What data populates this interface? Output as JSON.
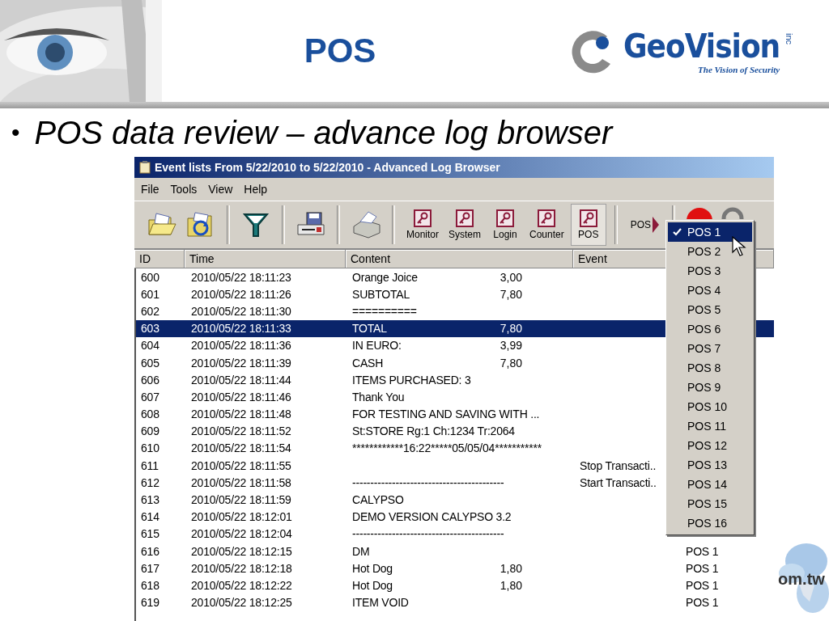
{
  "slide": {
    "title": "POS",
    "logo": {
      "name": "GeoVision",
      "suffix": "inc",
      "tagline": "The Vision of Security"
    },
    "bullet_mark": "•",
    "bullet": "POS data review – advance log browser",
    "corner_text": "om.tw"
  },
  "window": {
    "title": "Event lists From 5/22/2010 to 5/22/2010 - Advanced Log Browser"
  },
  "menu_bar": [
    "File",
    "Tools",
    "View",
    "Help"
  ],
  "toolbar": {
    "log_buttons": [
      {
        "label": "Monitor",
        "selected": false
      },
      {
        "label": "System",
        "selected": false
      },
      {
        "label": "Login",
        "selected": false
      },
      {
        "label": "Counter",
        "selected": false
      },
      {
        "label": "POS",
        "selected": true
      }
    ],
    "pos_menu_label": "POS"
  },
  "table": {
    "columns": [
      "ID",
      "Time",
      "Content",
      "Event"
    ],
    "rows": [
      {
        "id": "600",
        "time": "2010/05/22 18:11:23",
        "content": "Orange Joice",
        "amount": "3,00",
        "selected": false
      },
      {
        "id": "601",
        "time": "2010/05/22 18:11:26",
        "content": "SUBTOTAL",
        "amount": "7,80",
        "selected": false
      },
      {
        "id": "602",
        "time": "2010/05/22 18:11:30",
        "content": "==========",
        "selected": false
      },
      {
        "id": "603",
        "time": "2010/05/22 18:11:33",
        "content": "TOTAL",
        "amount": "7,80",
        "selected": true
      },
      {
        "id": "604",
        "time": "2010/05/22 18:11:36",
        "content": "IN EURO:",
        "amount": "3,99",
        "selected": false
      },
      {
        "id": "605",
        "time": "2010/05/22 18:11:39",
        "content": "CASH",
        "amount": "7,80",
        "selected": false
      },
      {
        "id": "606",
        "time": "2010/05/22 18:11:44",
        "content": "ITEMS PURCHASED: 3",
        "selected": false
      },
      {
        "id": "607",
        "time": "2010/05/22 18:11:46",
        "content": "Thank You",
        "selected": false
      },
      {
        "id": "608",
        "time": "2010/05/22 18:11:48",
        "content": "FOR TESTING AND SAVING WITH ...",
        "selected": false
      },
      {
        "id": "609",
        "time": "2010/05/22 18:11:52",
        "content": "St:STORE Rg:1 Ch:1234 Tr:2064",
        "selected": false
      },
      {
        "id": "610",
        "time": "2010/05/22 18:11:54",
        "content": "************16:22*****05/05/04***********",
        "selected": false
      },
      {
        "id": "611",
        "time": "2010/05/22 18:11:55",
        "event": "Stop Transacti..",
        "selected": false
      },
      {
        "id": "612",
        "time": "2010/05/22 18:11:58",
        "content": "------------------------------------------",
        "event": "Start Transacti..",
        "selected": false
      },
      {
        "id": "613",
        "time": "2010/05/22 18:11:59",
        "content": "CALYPSO",
        "selected": false
      },
      {
        "id": "614",
        "time": "2010/05/22 18:12:01",
        "content": "DEMO VERSION CALYPSO 3.2",
        "selected": false
      },
      {
        "id": "615",
        "time": "2010/05/22 18:12:04",
        "content": "------------------------------------------",
        "selected": false
      },
      {
        "id": "616",
        "time": "2010/05/22 18:12:15",
        "content": "DM",
        "pos": "POS 1",
        "selected": false
      },
      {
        "id": "617",
        "time": "2010/05/22 18:12:18",
        "content": "Hot Dog",
        "amount": "1,80",
        "pos": "POS 1",
        "selected": false
      },
      {
        "id": "618",
        "time": "2010/05/22 18:12:22",
        "content": "Hot Dog",
        "amount": "1,80",
        "pos": "POS 1",
        "selected": false
      },
      {
        "id": "619",
        "time": "2010/05/22 18:12:25",
        "content": "ITEM VOID",
        "pos": "POS 1",
        "selected": false
      }
    ]
  },
  "pos_menu": {
    "items": [
      {
        "label": "POS 1",
        "checked": true,
        "selected": true
      },
      {
        "label": "POS 2",
        "checked": false,
        "selected": false
      },
      {
        "label": "POS 3",
        "checked": false,
        "selected": false
      },
      {
        "label": "POS 4",
        "checked": false,
        "selected": false
      },
      {
        "label": "POS 5",
        "checked": false,
        "selected": false
      },
      {
        "label": "POS 6",
        "checked": false,
        "selected": false
      },
      {
        "label": "POS 7",
        "checked": false,
        "selected": false
      },
      {
        "label": "POS 8",
        "checked": false,
        "selected": false
      },
      {
        "label": "POS 9",
        "checked": false,
        "selected": false
      },
      {
        "label": "POS 10",
        "checked": false,
        "selected": false
      },
      {
        "label": "POS 11",
        "checked": false,
        "selected": false
      },
      {
        "label": "POS 12",
        "checked": false,
        "selected": false
      },
      {
        "label": "POS 13",
        "checked": false,
        "selected": false
      },
      {
        "label": "POS 14",
        "checked": false,
        "selected": false
      },
      {
        "label": "POS 15",
        "checked": false,
        "selected": false
      },
      {
        "label": "POS 16",
        "checked": false,
        "selected": false
      }
    ]
  }
}
